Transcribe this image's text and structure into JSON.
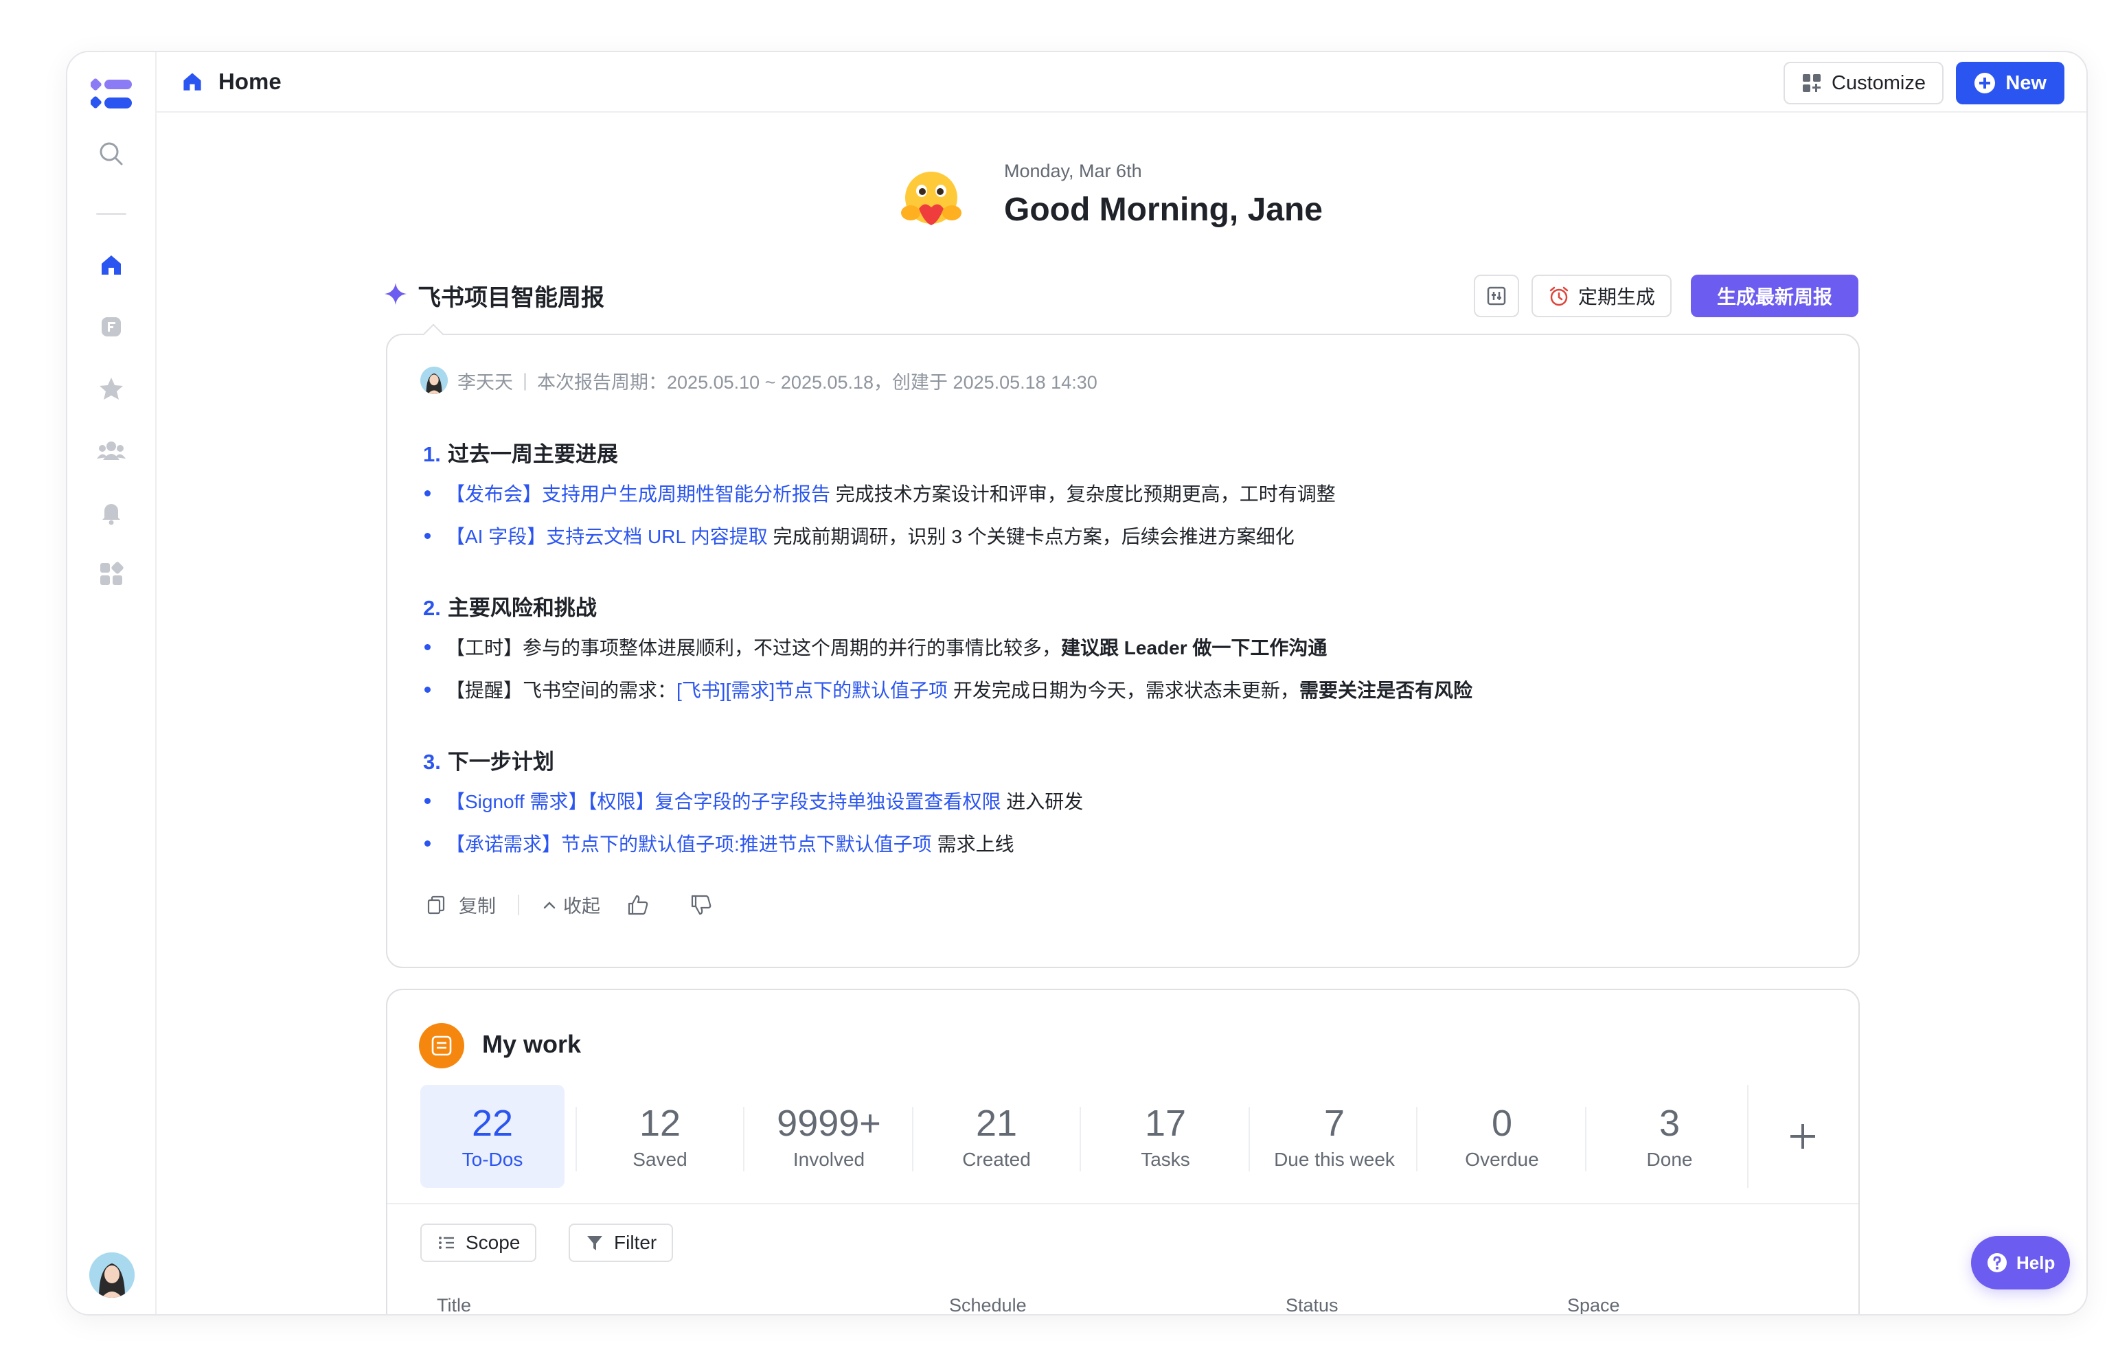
{
  "topbar": {
    "home_label": "Home",
    "customize_label": "Customize",
    "new_label": "New"
  },
  "greeting": {
    "date": "Monday, Mar 6th",
    "title": "Good Morning, Jane"
  },
  "report": {
    "title": "飞书项目智能周报",
    "timed_label": "定期生成",
    "generate_label": "生成最新周报",
    "author": "李天天",
    "meta": "本次报告周期：2025.05.10 ~ 2025.05.18，创建于 2025.05.18 14:30",
    "sections": [
      {
        "num": "1.",
        "title": "过去一周主要进展",
        "items": [
          {
            "link": "【发布会】支持用户生成周期性智能分析报告",
            "text": " 完成技术方案设计和评审，复杂度比预期更高，工时有调整"
          },
          {
            "link": "【AI 字段】支持云文档 URL 内容提取",
            "text": " 完成前期调研，识别 3 个关键卡点方案，后续会推进方案细化"
          }
        ]
      },
      {
        "num": "2.",
        "title": "主要风险和挑战",
        "items": [
          {
            "pre": "【工时】参与的事项整体进展顺利，不过这个周期的并行的事情比较多，",
            "bold": "建议跟 Leader 做一下工作沟通"
          },
          {
            "pre": "【提醒】飞书空间的需求：",
            "link": "[飞书][需求]节点下的默认值子项",
            "text": " 开发完成日期为今天，需求状态未更新，",
            "bold": "需要关注是否有风险"
          }
        ]
      },
      {
        "num": "3.",
        "title": "下一步计划",
        "items": [
          {
            "link": "【Signoff 需求】【权限】复合字段的子字段支持单独设置查看权限",
            "text": " 进入研发"
          },
          {
            "link": "【承诺需求】节点下的默认值子项:推进节点下默认值子项",
            "text": " 需求上线"
          }
        ]
      }
    ],
    "copy_label": "复制",
    "collapse_label": "收起"
  },
  "work": {
    "title": "My work",
    "stats": [
      {
        "value": "22",
        "label": "To-Dos"
      },
      {
        "value": "12",
        "label": "Saved"
      },
      {
        "value": "9999+",
        "label": "Involved"
      },
      {
        "value": "21",
        "label": "Created"
      },
      {
        "value": "17",
        "label": "Tasks"
      },
      {
        "value": "7",
        "label": "Due this week"
      },
      {
        "value": "0",
        "label": "Overdue"
      },
      {
        "value": "3",
        "label": "Done"
      }
    ],
    "scope_label": "Scope",
    "filter_label": "Filter",
    "columns": [
      "Title",
      "Schedule",
      "Status",
      "Space"
    ]
  },
  "help_label": "Help",
  "colors": {
    "accent": "#2b55f0",
    "purple": "#6c5cf0",
    "orange": "#f5870f"
  }
}
